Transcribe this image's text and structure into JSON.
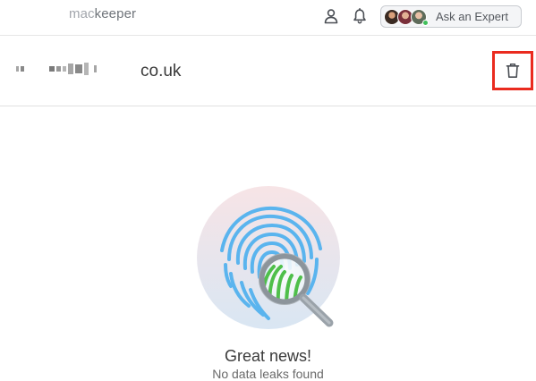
{
  "app": {
    "logo_mac": "mac",
    "logo_keeper": "keeper",
    "expert_button_label": "Ask an Expert"
  },
  "icons": {
    "user": "user-icon",
    "bell": "bell-icon",
    "trash": "trash-icon",
    "fingerprint": "fingerprint-magnifier-icon"
  },
  "email_row": {
    "email_suffix": "co.uk",
    "highlight_color": "#ea2b1f"
  },
  "result": {
    "title": "Great news!",
    "subtitle": "No data leaks found"
  },
  "colors": {
    "fingerprint_blue": "#5ab4ee",
    "fingerprint_green": "#4fbf4a",
    "online": "#3fbf5a"
  }
}
